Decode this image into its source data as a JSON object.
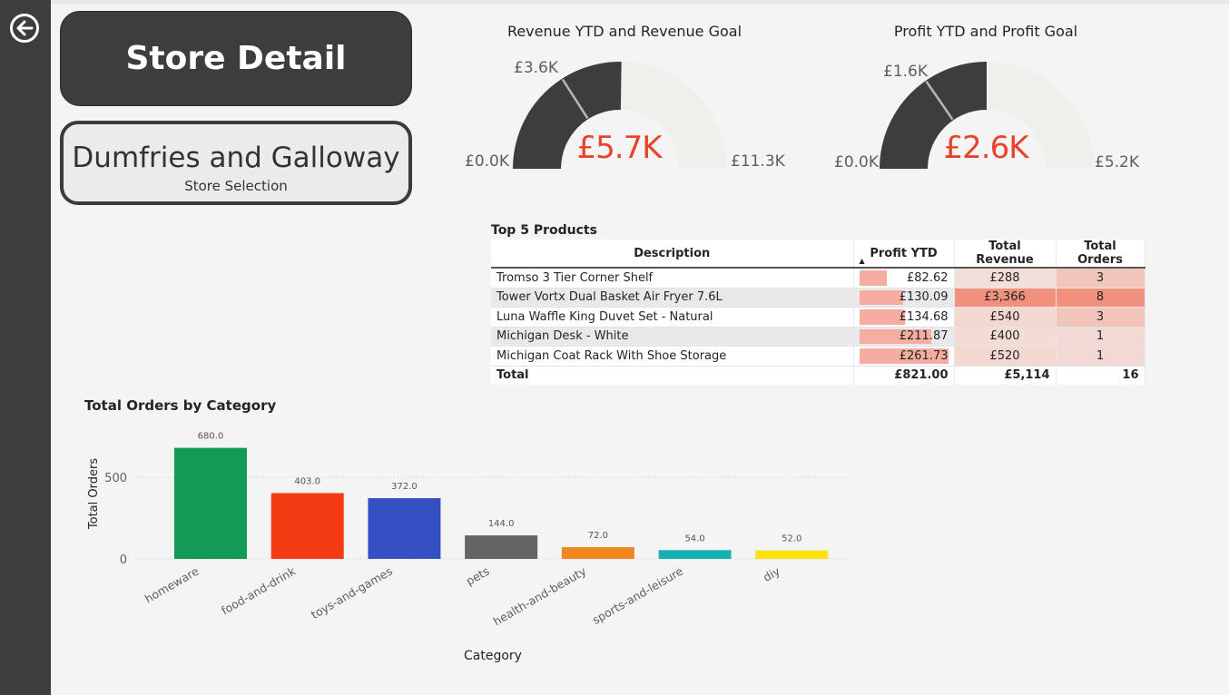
{
  "page": {
    "title": "Store Detail",
    "store_selection": {
      "value": "Dumfries and Galloway",
      "label": "Store Selection"
    }
  },
  "gauges": [
    {
      "title": "Revenue YTD and Revenue Goal",
      "value_label": "£5.7K",
      "value": 5.7,
      "min_label": "£0.0K",
      "min": 0,
      "max_label": "£11.3K",
      "max": 11.3,
      "target_label": "£3.6K",
      "target": 3.6
    },
    {
      "title": "Profit YTD and Profit Goal",
      "value_label": "£2.6K",
      "value": 2.6,
      "min_label": "£0.0K",
      "min": 0,
      "max_label": "£5.2K",
      "max": 5.2,
      "target_label": "£1.6K",
      "target": 1.6
    }
  ],
  "top_products": {
    "title": "Top 5 Products",
    "columns": [
      "Description",
      "Profit YTD",
      "Total Revenue",
      "Total Orders"
    ],
    "rows": [
      {
        "description": "Tromso 3 Tier Corner Shelf",
        "profit": "£82.62",
        "profit_value": 82.62,
        "revenue": "£288",
        "revenue_value": 288,
        "orders": "3",
        "orders_value": 3
      },
      {
        "description": "Tower Vortx Dual Basket Air Fryer 7.6L",
        "profit": "£130.09",
        "profit_value": 130.09,
        "revenue": "£3,366",
        "revenue_value": 3366,
        "orders": "8",
        "orders_value": 8
      },
      {
        "description": "Luna Waffle King Duvet Set - Natural",
        "profit": "£134.68",
        "profit_value": 134.68,
        "revenue": "£540",
        "revenue_value": 540,
        "orders": "3",
        "orders_value": 3
      },
      {
        "description": "Michigan Desk - White",
        "profit": "£211.87",
        "profit_value": 211.87,
        "revenue": "£400",
        "revenue_value": 400,
        "orders": "1",
        "orders_value": 1
      },
      {
        "description": "Michigan Coat Rack With Shoe Storage",
        "profit": "£261.73",
        "profit_value": 261.73,
        "revenue": "£520",
        "revenue_value": 520,
        "orders": "1",
        "orders_value": 1
      }
    ],
    "total": {
      "label": "Total",
      "profit": "£821.00",
      "revenue": "£5,114",
      "orders": "16"
    }
  },
  "colors": {
    "gauge_fill": "#3d3d3d",
    "gauge_track": "#f0efec",
    "gauge_value": "#e8432a",
    "table_highlight": "#f4ada0"
  },
  "chart_data": {
    "type": "bar",
    "title": "Total Orders by Category",
    "xlabel": "Category",
    "ylabel": "Total Orders",
    "categories": [
      "homeware",
      "food-and-drink",
      "toys-and-games",
      "pets",
      "health-and-beauty",
      "sports-and-leisure",
      "diy"
    ],
    "values": [
      680,
      403,
      372,
      144,
      72,
      54,
      52
    ],
    "data_labels": [
      "680.0",
      "403.0",
      "372.0",
      "144.0",
      "72.0",
      "54.0",
      "52.0"
    ],
    "colors": [
      "#129b54",
      "#f53b13",
      "#3450c2",
      "#646464",
      "#f0861d",
      "#16b1b3",
      "#fae310"
    ],
    "yticks": [
      0,
      500
    ],
    "ylim": [
      0,
      700
    ],
    "grid": true
  }
}
